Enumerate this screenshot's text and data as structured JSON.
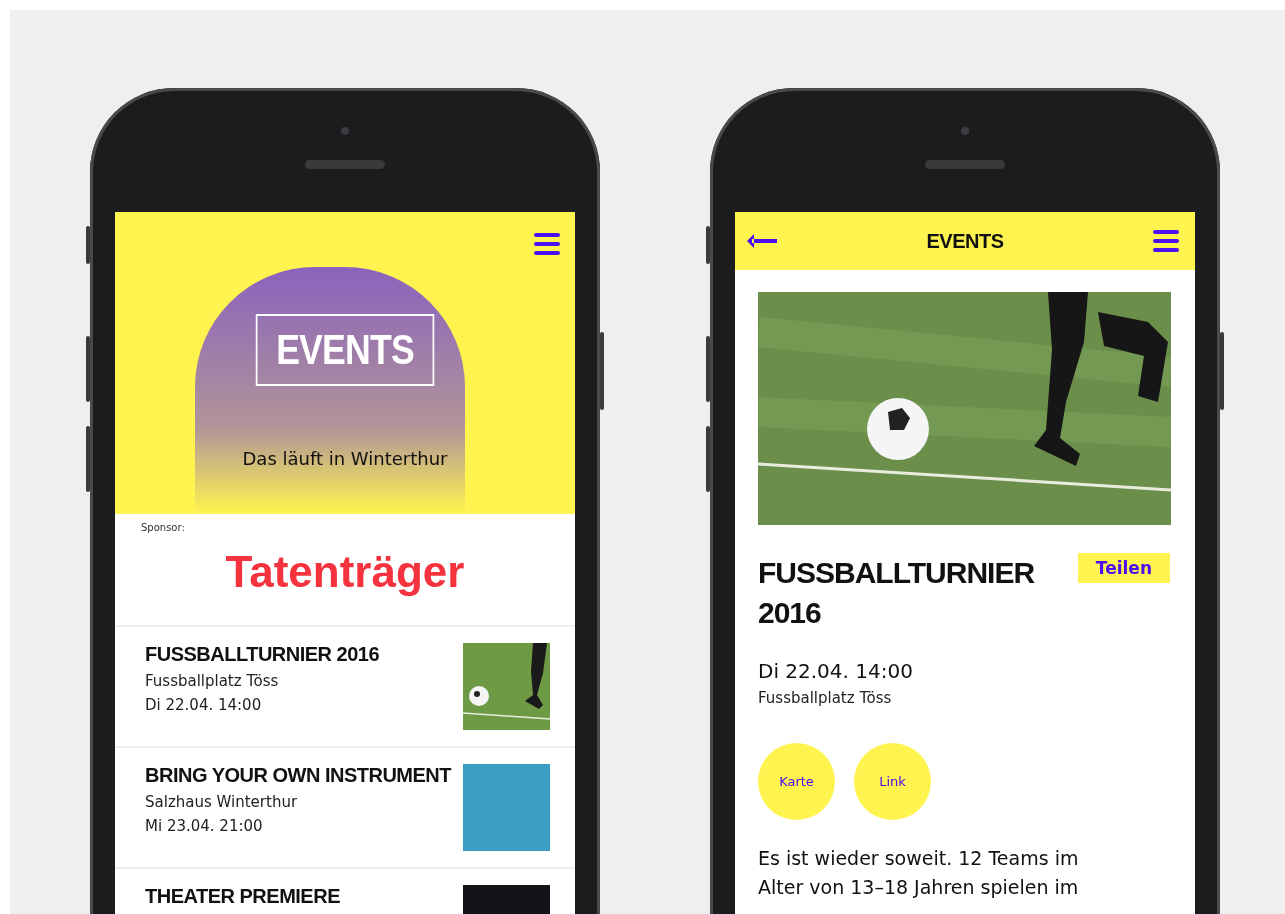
{
  "list_screen": {
    "hero": {
      "title": "EVENTS",
      "subtitle": "Das läuft in Winterthur"
    },
    "sponsor": {
      "label": "Sponsor:",
      "name": "Tatenträger"
    },
    "events": [
      {
        "title": "FUSSBALLTURNIER 2016",
        "venue": "Fussballplatz Töss",
        "date": "Di 22.04. 14:00",
        "kind": "football"
      },
      {
        "title": "BRING YOUR OWN INSTRUMENT",
        "venue": "Salzhaus Winterthur",
        "date": "Mi 23.04. 21:00",
        "kind": "logo"
      },
      {
        "title": "THEATER PREMIERE",
        "kind": "stage"
      }
    ]
  },
  "detail_screen": {
    "header": {
      "title": "EVENTS"
    },
    "title": "FUSSBALLTURNIER 2016",
    "share_button": "Teilen",
    "date": "Di 22.04. 14:00",
    "venue": "Fussballplatz Töss",
    "actions": [
      "Karte",
      "Link"
    ],
    "description": "Es ist wieder soweit. 12 Teams im Alter von 13–18 Jahren spielen im"
  }
}
